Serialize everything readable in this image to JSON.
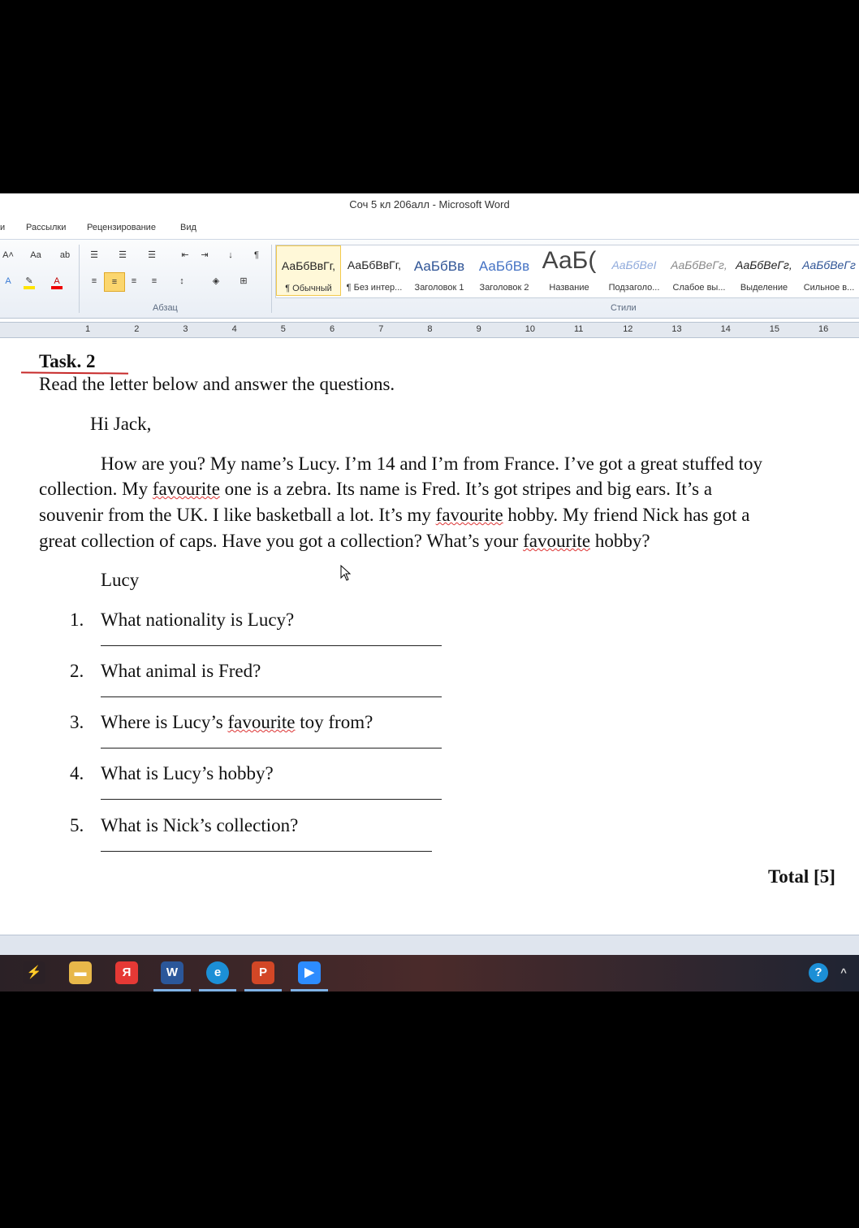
{
  "window": {
    "title": "Соч 5 кл 206алл  -  Microsoft Word"
  },
  "tabs": [
    "и",
    "Рассылки",
    "Рецензирование",
    "Вид"
  ],
  "ribbon": {
    "paragraph_label": "Абзац",
    "styles_label": "Стили",
    "styles": [
      {
        "sample": "АаБбВвГг,",
        "name": "¶ Обычный",
        "color": "#222222"
      },
      {
        "sample": "АаБбВвГг,",
        "name": "¶ Без интер...",
        "color": "#222222"
      },
      {
        "sample": "АаБбВв",
        "name": "Заголовок 1",
        "color": "#2f5496"
      },
      {
        "sample": "АаБбВв",
        "name": "Заголовок 2",
        "color": "#4472c4"
      },
      {
        "sample": "АаБ(",
        "name": "Название",
        "color": "#444444"
      },
      {
        "sample": "АаБбВеІ",
        "name": "Подзаголо...",
        "color": "#8ea9db"
      },
      {
        "sample": "АаБбВеГг,",
        "name": "Слабое вы...",
        "color": "#888888"
      },
      {
        "sample": "АаБбВеГг,",
        "name": "Выделение",
        "color": "#222222"
      },
      {
        "sample": "АаБбВеГг",
        "name": "Сильное в...",
        "color": "#2f5496"
      }
    ],
    "font_labels": {
      "grow": "A˄",
      "case": "Aa",
      "pilcrow": "¶"
    }
  },
  "ruler": {
    "numbers": [
      "1",
      "2",
      "3",
      "4",
      "5",
      "6",
      "7",
      "8",
      "9",
      "10",
      "11",
      "12",
      "13",
      "14",
      "15",
      "16"
    ]
  },
  "document": {
    "task_title": "Task. 2",
    "instruction": "Read the letter below and answer the questions.",
    "greeting": "Hi Jack,",
    "letter_lines": [
      [
        "How are you? My name’s Lucy. I’m 14 and I’m from France. I’ve got a great stuffed toy"
      ],
      [
        "collection. My ",
        "favourite",
        " one is a zebra. Its name is Fred. It’s got stripes and big ears. It’s a"
      ],
      [
        "souvenir from the UK. I like basketball a lot. It’s my ",
        "favourite",
        " hobby. My friend Nick has got a"
      ],
      [
        "great collection of caps. Have you got a collection? What’s your ",
        "favourite",
        " hobby?"
      ]
    ],
    "signature": "Lucy",
    "questions": [
      {
        "num": "1.",
        "text": "What nationality is Lucy?"
      },
      {
        "num": "2.",
        "text": "What animal is Fred?"
      },
      {
        "num": "3.",
        "pre": "Where is Lucy’s ",
        "ul": "favourite",
        "post": " toy from?"
      },
      {
        "num": "4.",
        "text": "What is Lucy’s hobby?"
      },
      {
        "num": "5.",
        "text": "What is Nick’s collection?"
      }
    ],
    "total": "Total [5]"
  },
  "taskbar": {
    "icons": [
      {
        "name": "bolt-app-icon",
        "glyph": "⚡",
        "color": "#2b2126"
      },
      {
        "name": "file-explorer-icon",
        "glyph": "▬",
        "color": "#e8b84a"
      },
      {
        "name": "yandex-browser-icon",
        "glyph": "Я",
        "color": "#e53935"
      },
      {
        "name": "word-icon",
        "glyph": "W",
        "color": "#2b579a"
      },
      {
        "name": "edge-icon",
        "glyph": "e",
        "color": "#1c8fd6"
      },
      {
        "name": "powerpoint-icon",
        "glyph": "P",
        "color": "#d24726"
      },
      {
        "name": "zoom-icon",
        "glyph": "▶",
        "color": "#2d8cff"
      }
    ],
    "help_glyph": "?",
    "chevron_glyph": "^"
  }
}
